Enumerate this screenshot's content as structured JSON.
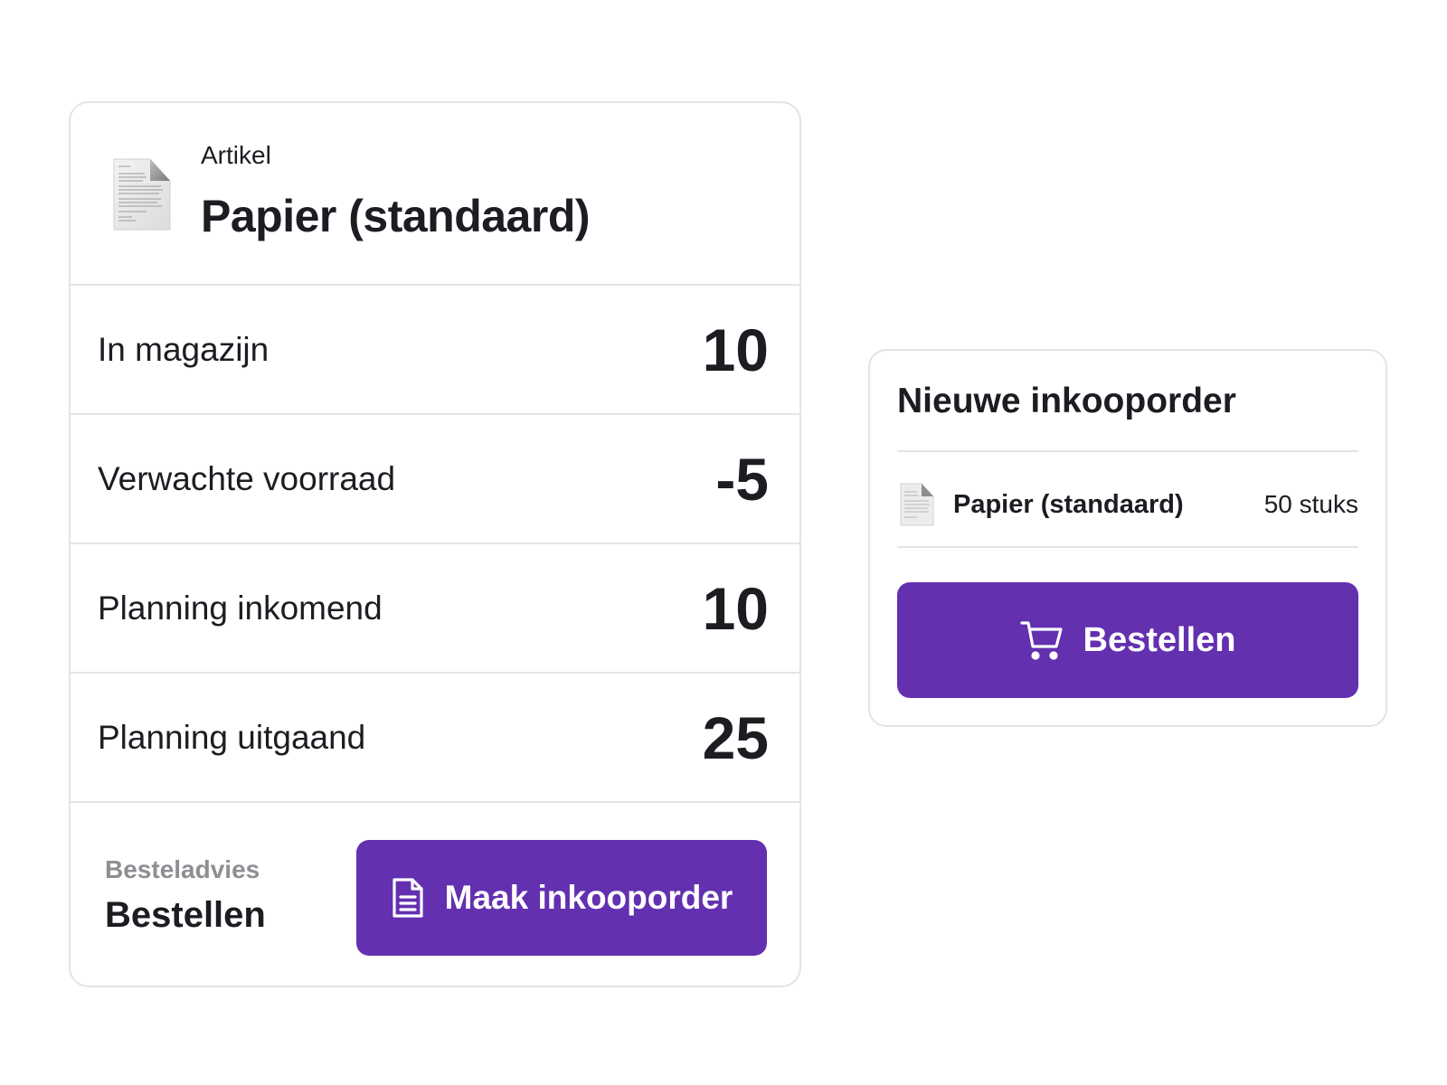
{
  "article_card": {
    "label": "Artikel",
    "title": "Papier (standaard)",
    "thumbnail_icon": "paper-document-icon",
    "stats": [
      {
        "label": "In magazijn",
        "value": "10"
      },
      {
        "label": "Verwachte voorraad",
        "value": "-5"
      },
      {
        "label": "Planning inkomend",
        "value": "10"
      },
      {
        "label": "Planning uitgaand",
        "value": "25"
      }
    ],
    "advice": {
      "label": "Besteladvies",
      "value": "Bestellen"
    },
    "make_order_button": {
      "label": "Maak inkooporder",
      "icon": "document-icon"
    }
  },
  "order_card": {
    "title": "Nieuwe inkooporder",
    "item": {
      "name": "Papier (standaard)",
      "quantity": "50 stuks",
      "icon": "paper-document-icon"
    },
    "order_button": {
      "label": "Bestellen",
      "icon": "cart-icon"
    }
  },
  "colors": {
    "primary": "#6330b0",
    "text": "#1c1d22",
    "muted": "#8e8e93",
    "border": "#e4e4e7"
  }
}
